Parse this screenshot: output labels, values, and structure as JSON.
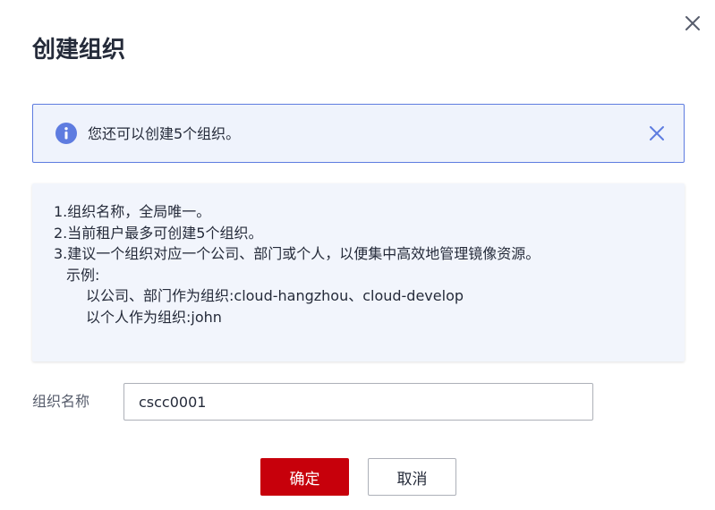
{
  "dialog": {
    "title": "创建组织",
    "close_icon": "close-icon"
  },
  "alert": {
    "icon": "info-icon",
    "text": "您还可以创建5个组织。",
    "close_icon": "close-icon",
    "accent_color": "#5e7ce0"
  },
  "notes": {
    "lines": [
      "1.组织名称，全局唯一。",
      "2.当前租户最多可创建5个组织。",
      "3.建议一个组织对应一个公司、部门或个人，以便集中高效地管理镜像资源。",
      "示例:",
      "以公司、部门作为组织:cloud-hangzhou、cloud-develop",
      "以个人作为组织:john"
    ]
  },
  "form": {
    "org_name_label": "组织名称",
    "org_name_value": "cscc0001"
  },
  "buttons": {
    "ok_label": "确定",
    "cancel_label": "取消",
    "primary_color": "#c7000b"
  }
}
